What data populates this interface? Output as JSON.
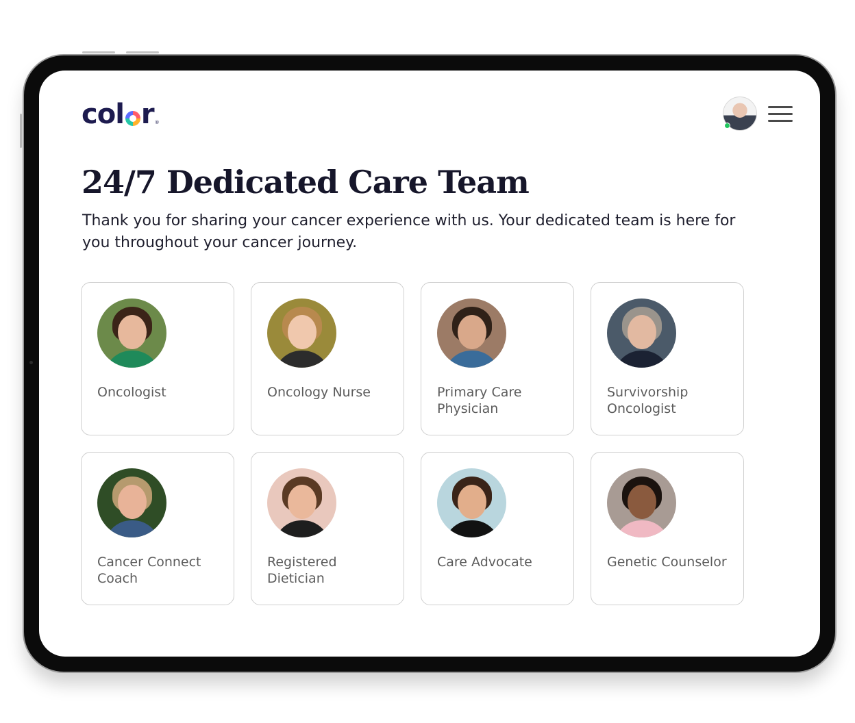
{
  "brand": {
    "logo_left": "col",
    "logo_right": "r",
    "logo_mark": "®"
  },
  "header": {
    "avatar_icon": "user-avatar-icon",
    "status": "online",
    "menu_icon": "hamburger-menu-icon"
  },
  "page": {
    "title": "24/7 Dedicated Care Team",
    "subtitle": "Thank you for sharing your cancer experience with us. Your dedicated team is here for you throughout your cancer journey."
  },
  "team": [
    {
      "role": "Oncologist",
      "bg": "#6c8a4a",
      "hair": "#3b2418",
      "skin": "#e7b89c",
      "shirt": "#1f8a5a"
    },
    {
      "role": "Oncology Nurse",
      "bg": "#9a8a3a",
      "hair": "#b8894e",
      "skin": "#f0c8ad",
      "shirt": "#2c2c2c"
    },
    {
      "role": "Primary Care Physician",
      "bg": "#9c7b66",
      "hair": "#2f2118",
      "skin": "#d9a88a",
      "shirt": "#3a6c9a"
    },
    {
      "role": "Survivorship Oncologist",
      "bg": "#4b5a69",
      "hair": "#9a948c",
      "skin": "#e2b9a1",
      "shirt": "#1b2233"
    },
    {
      "role": "Cancer Connect Coach",
      "bg": "#2f4d26",
      "hair": "#b69a6e",
      "skin": "#e8b398",
      "shirt": "#3a5b86"
    },
    {
      "role": "Registered Dietician",
      "bg": "#e9c8bd",
      "hair": "#5a3a24",
      "skin": "#eab89b",
      "shirt": "#1e1e1e"
    },
    {
      "role": "Care Advocate",
      "bg": "#b9d6de",
      "hair": "#3a2418",
      "skin": "#e2ae8b",
      "shirt": "#121212"
    },
    {
      "role": "Genetic Counselor",
      "bg": "#a89b94",
      "hair": "#1a120e",
      "skin": "#8a5a3e",
      "shirt": "#f0b9c3"
    }
  ]
}
